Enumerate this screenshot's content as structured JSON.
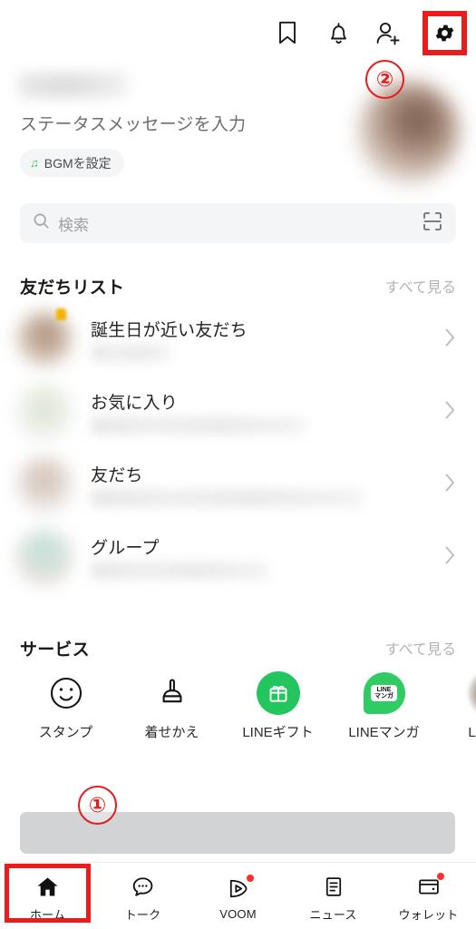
{
  "topbar": {
    "icons": [
      {
        "name": "bookmark-icon",
        "label": "ブックマーク"
      },
      {
        "name": "bell-icon",
        "label": "通知"
      },
      {
        "name": "add-friend-icon",
        "label": "友だち追加"
      },
      {
        "name": "gear-icon",
        "label": "設定"
      }
    ]
  },
  "annotations": {
    "badge_one": "①",
    "badge_two": "②",
    "highlight_color": "#ea1c1c"
  },
  "profile": {
    "display_name": "",
    "status_message": "ステータスメッセージを入力",
    "bgm_label": "BGMを設定",
    "bgm_icon": "music-note-icon",
    "avatar": "profile-avatar"
  },
  "search": {
    "placeholder": "検索",
    "icon": "search-icon",
    "scan_icon": "qr-scan-icon"
  },
  "friends_section": {
    "title": "友だちリスト",
    "more_label": "すべて見る",
    "rows": [
      {
        "label": "誕生日が近い友だち",
        "avatar": "birthday-avatar",
        "chevron": "chevron-right-icon"
      },
      {
        "label": "お気に入り",
        "avatar": "favorite-avatar",
        "chevron": "chevron-right-icon"
      },
      {
        "label": "友だち",
        "avatar": "friends-avatar",
        "chevron": "chevron-right-icon"
      },
      {
        "label": "グループ",
        "avatar": "groups-avatar",
        "chevron": "chevron-right-icon"
      }
    ]
  },
  "services_section": {
    "title": "サービス",
    "more_label": "すべて見る",
    "items": [
      {
        "label": "スタンプ",
        "icon": "sticker-smiley-icon"
      },
      {
        "label": "着せかえ",
        "icon": "theme-brush-icon"
      },
      {
        "label": "LINEギフト",
        "icon": "gift-icon"
      },
      {
        "label": "LINEマンガ",
        "icon": "manga-icon"
      },
      {
        "label": "LI\nCam",
        "icon": "line-camera-icon"
      }
    ]
  },
  "banner": {
    "name": "promo-banner",
    "text": ""
  },
  "bottom_nav": {
    "items": [
      {
        "label": "ホーム",
        "icon": "home-icon",
        "active": true,
        "dot": false
      },
      {
        "label": "トーク",
        "icon": "chat-bubble-icon",
        "active": false,
        "dot": false
      },
      {
        "label": "VOOM",
        "icon": "voom-play-icon",
        "active": false,
        "dot": true
      },
      {
        "label": "ニュース",
        "icon": "news-icon",
        "active": false,
        "dot": false
      },
      {
        "label": "ウォレット",
        "icon": "wallet-icon",
        "active": false,
        "dot": true
      }
    ]
  }
}
